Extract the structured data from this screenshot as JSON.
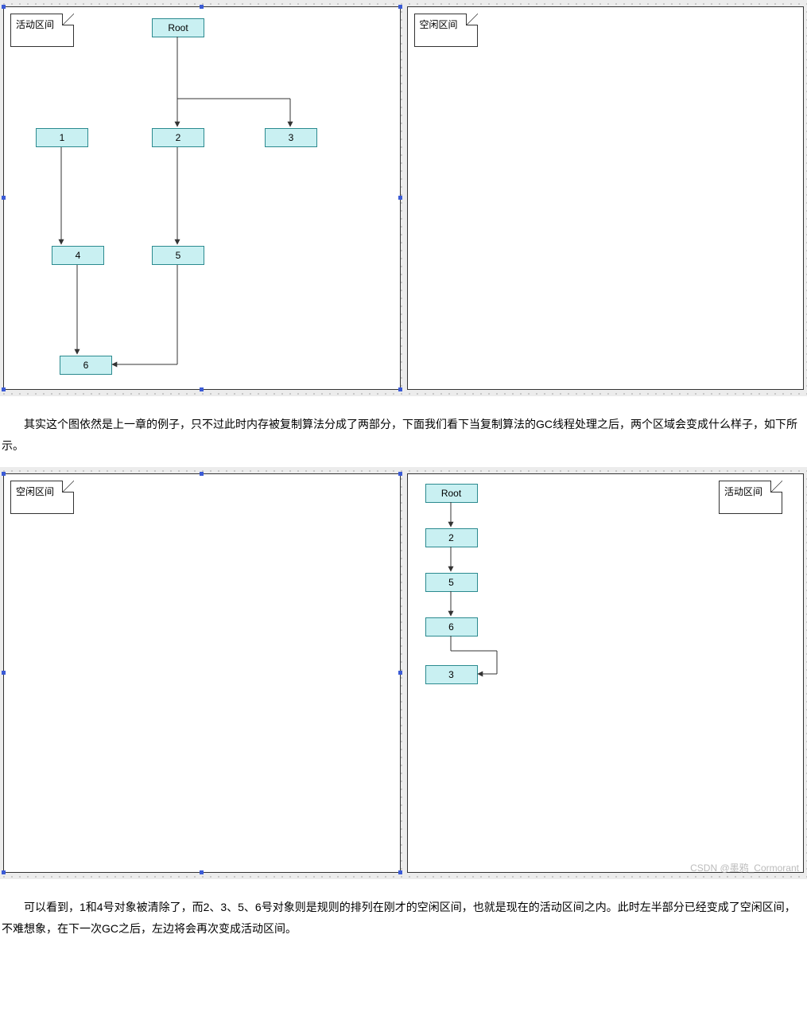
{
  "diagram1": {
    "left_label": "活动区间",
    "right_label": "空闲区间",
    "nodes": {
      "root": "Root",
      "n1": "1",
      "n2": "2",
      "n3": "3",
      "n4": "4",
      "n5": "5",
      "n6": "6"
    }
  },
  "para1": "其实这个图依然是上一章的例子，只不过此时内存被复制算法分成了两部分，下面我们看下当复制算法的GC线程处理之后，两个区域会变成什么样子，如下所示。",
  "diagram2": {
    "left_label": "空闲区间",
    "right_label": "活动区间",
    "nodes": {
      "root": "Root",
      "n2": "2",
      "n5": "5",
      "n6": "6",
      "n3": "3"
    }
  },
  "para2": "可以看到，1和4号对象被清除了，而2、3、5、6号对象则是规则的排列在刚才的空闲区间，也就是现在的活动区间之内。此时左半部分已经变成了空闲区间，不难想象，在下一次GC之后，左边将会再次变成活动区间。",
  "watermark": "CSDN @墨鸦_Cormorant",
  "chart_data": [
    {
      "type": "flow-tree",
      "title": "复制算法 — GC 前",
      "regions": [
        {
          "name": "活动区间",
          "nodes": [
            "Root",
            "1",
            "2",
            "3",
            "4",
            "5",
            "6"
          ],
          "edges": [
            [
              "Root",
              "2"
            ],
            [
              "2",
              "1"
            ],
            [
              "2",
              "3"
            ],
            [
              "1",
              "4"
            ],
            [
              "2",
              "5"
            ],
            [
              "4",
              "6"
            ],
            [
              "5",
              "6"
            ]
          ]
        },
        {
          "name": "空闲区间",
          "nodes": [],
          "edges": []
        }
      ]
    },
    {
      "type": "flow-chain",
      "title": "复制算法 — GC 后",
      "regions": [
        {
          "name": "空闲区间",
          "nodes": [],
          "edges": []
        },
        {
          "name": "活动区间",
          "nodes": [
            "Root",
            "2",
            "5",
            "6",
            "3"
          ],
          "edges": [
            [
              "Root",
              "2"
            ],
            [
              "2",
              "5"
            ],
            [
              "5",
              "6"
            ],
            [
              "6",
              "3"
            ]
          ]
        }
      ]
    }
  ]
}
